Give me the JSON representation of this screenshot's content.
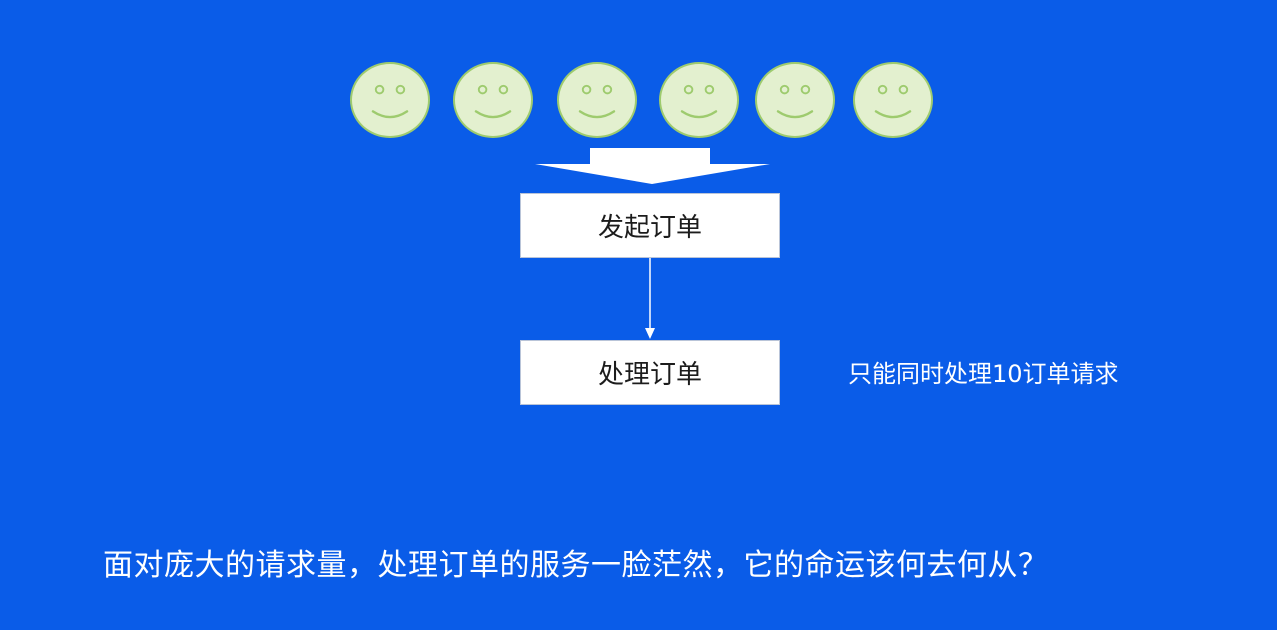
{
  "colors": {
    "background": "#0a5ce8",
    "face_fill": "#e3f0cf",
    "face_stroke": "#9ecb6e",
    "box_fill": "#ffffff",
    "text_light": "#ffffff",
    "text_dark": "#1c1c1c"
  },
  "users": {
    "count": 6,
    "icon": "smiley-face-icon"
  },
  "flow": {
    "icon_arrow_in": "wide-down-arrow-icon",
    "icon_connector": "down-arrow-icon",
    "step1_label": "发起订单",
    "step2_label": "处理订单"
  },
  "side_note": "只能同时处理10订单请求",
  "caption": "面对庞大的请求量，处理订单的服务一脸茫然，它的命运该何去何从？"
}
